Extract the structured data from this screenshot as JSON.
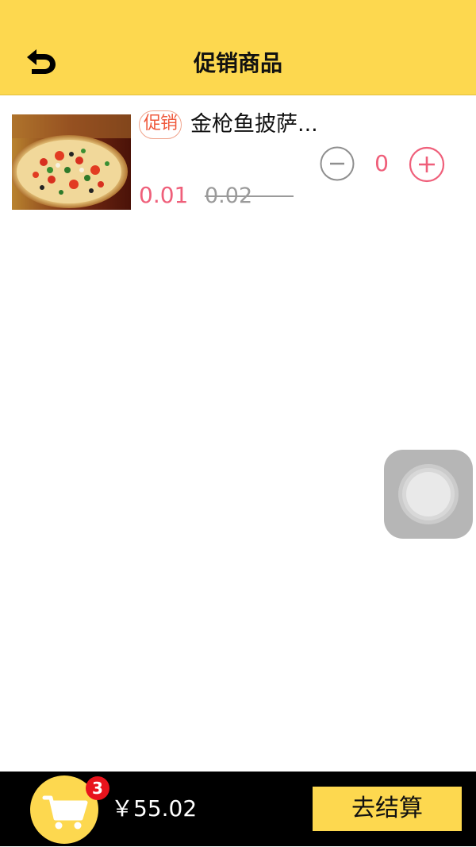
{
  "header": {
    "title": "促销商品",
    "back_icon": "back-arrow-icon",
    "background": "#fdd84f"
  },
  "product": {
    "tag": "促销",
    "name": "金枪鱼披萨...",
    "price_now": "0.01",
    "price_old": "0.02",
    "quantity": "0",
    "image_icon": "pizza-image"
  },
  "footer": {
    "cart_icon": "cart-icon",
    "badge_count": "3",
    "total": "￥55.02",
    "checkout_label": "去结算"
  },
  "colors": {
    "accent_yellow": "#fdd84f",
    "price_pink": "#ef5f7a",
    "tag_orange": "#ef5a3d",
    "badge_red": "#e8131c"
  }
}
